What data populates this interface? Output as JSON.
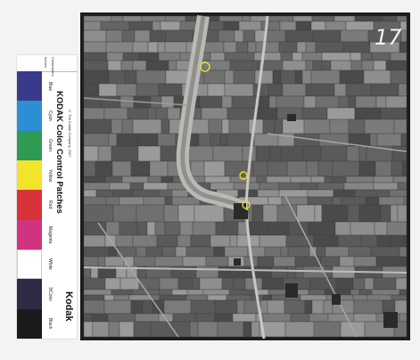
{
  "scan": {
    "frame_number": "17",
    "photo_kind": "aerial photograph"
  },
  "color_strip": {
    "title": "KODAK Color Control Patches",
    "subtitle": "© The Kodak Company, 2007",
    "brand": "Kodak",
    "ruler_labels": [
      "Inches",
      "Centimeters"
    ],
    "patches": [
      {
        "label": "Blue",
        "color": "#3a3a8c"
      },
      {
        "label": "Cyan",
        "color": "#2c8fd4"
      },
      {
        "label": "Green",
        "color": "#2f9a52"
      },
      {
        "label": "Yellow",
        "color": "#f2e32b"
      },
      {
        "label": "Red",
        "color": "#d8323a"
      },
      {
        "label": "Magenta",
        "color": "#d0347f"
      },
      {
        "label": "White",
        "color": "#ffffff"
      },
      {
        "label": "3/Color",
        "color": "#2e2a45"
      },
      {
        "label": "Black",
        "color": "#1a1a1a"
      }
    ]
  },
  "markers": [
    {
      "name": "marker-1",
      "color": "#e8e02a"
    },
    {
      "name": "marker-2",
      "color": "#e8e02a"
    },
    {
      "name": "marker-3",
      "color": "#e8e02a"
    }
  ]
}
